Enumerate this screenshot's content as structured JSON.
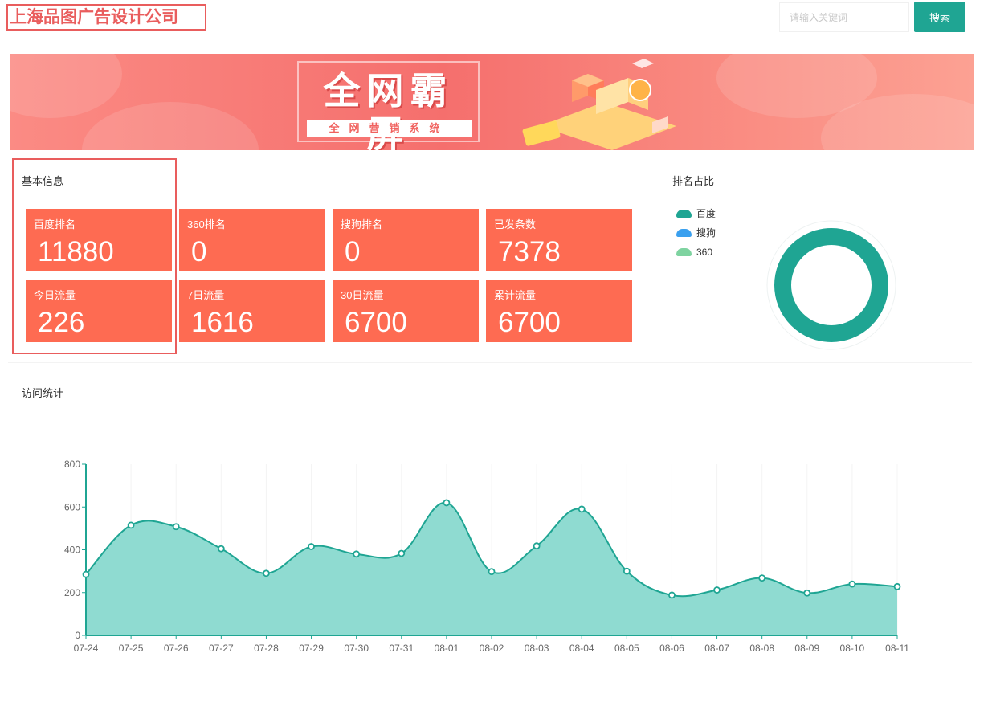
{
  "header": {
    "company_title": "上海品图广告设计公司",
    "search_placeholder": "请输入关键词",
    "search_button": "搜索"
  },
  "banner": {
    "title": "全网霸屏",
    "subtitle": "全网营销系统"
  },
  "basic_info": {
    "title": "基本信息",
    "stats": [
      {
        "label": "百度排名",
        "value": "11880"
      },
      {
        "label": "360排名",
        "value": "0"
      },
      {
        "label": "搜狗排名",
        "value": "0"
      },
      {
        "label": "已发条数",
        "value": "7378"
      },
      {
        "label": "今日流量",
        "value": "226"
      },
      {
        "label": "7日流量",
        "value": "1616"
      },
      {
        "label": "30日流量",
        "value": "6700"
      },
      {
        "label": "累计流量",
        "value": "6700"
      }
    ]
  },
  "ranking_share": {
    "title": "排名占比",
    "legend": [
      {
        "name": "百度",
        "color": "#1fa593"
      },
      {
        "name": "搜狗",
        "color": "#3aa0ef"
      },
      {
        "name": "360",
        "color": "#7ed3a0"
      }
    ]
  },
  "visits": {
    "title": "访问统计"
  },
  "chart_data": [
    {
      "type": "pie",
      "labels": [
        "百度",
        "搜狗",
        "360"
      ],
      "values": [
        100,
        0,
        0
      ],
      "colors": [
        "#1fa593",
        "#3aa0ef",
        "#7ed3a0"
      ],
      "legend": "left"
    },
    {
      "type": "area",
      "x": [
        "07-24",
        "07-25",
        "07-26",
        "07-27",
        "07-28",
        "07-29",
        "07-30",
        "07-31",
        "08-01",
        "08-02",
        "08-03",
        "08-04",
        "08-05",
        "08-06",
        "08-07",
        "08-08",
        "08-09",
        "08-10",
        "08-11"
      ],
      "series": [
        {
          "values": [
            285,
            515,
            508,
            405,
            290,
            415,
            380,
            383,
            620,
            298,
            418,
            590,
            300,
            188,
            212,
            268,
            198,
            240,
            228
          ]
        }
      ],
      "ylim": [
        0,
        800
      ],
      "yticks": [
        0,
        200,
        400,
        600,
        800
      ],
      "color": "#1fa593",
      "fill": "#8fdbd1",
      "grid": true
    }
  ]
}
